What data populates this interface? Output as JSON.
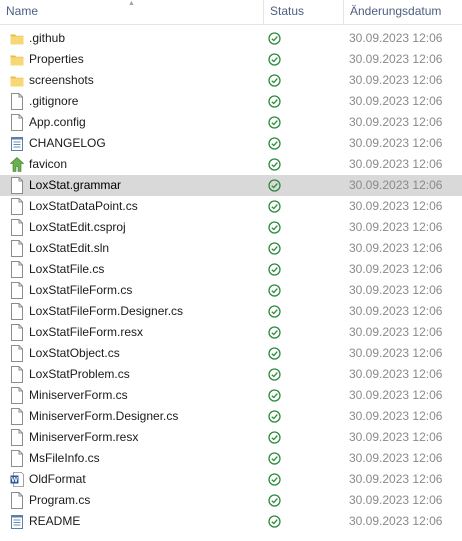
{
  "header": {
    "name_label": "Name",
    "status_label": "Status",
    "date_label": "Änderungsdatum"
  },
  "files": [
    {
      "name": ".github",
      "icon": "folder-icon",
      "status": "synced-icon",
      "date": "30.09.2023 12:06"
    },
    {
      "name": "Properties",
      "icon": "folder-icon",
      "status": "synced-icon",
      "date": "30.09.2023 12:06"
    },
    {
      "name": "screenshots",
      "icon": "folder-icon",
      "status": "synced-icon",
      "date": "30.09.2023 12:06"
    },
    {
      "name": ".gitignore",
      "icon": "file-icon",
      "status": "synced-icon",
      "date": "30.09.2023 12:06"
    },
    {
      "name": "App.config",
      "icon": "file-icon",
      "status": "synced-icon",
      "date": "30.09.2023 12:06"
    },
    {
      "name": "CHANGELOG",
      "icon": "text-document-icon",
      "status": "synced-icon",
      "date": "30.09.2023 12:06"
    },
    {
      "name": "favicon",
      "icon": "favicon-icon",
      "status": "synced-icon",
      "date": "30.09.2023 12:06"
    },
    {
      "name": "LoxStat.grammar",
      "icon": "file-icon",
      "status": "synced-icon",
      "date": "30.09.2023 12:06",
      "selected": true
    },
    {
      "name": "LoxStatDataPoint.cs",
      "icon": "file-icon",
      "status": "synced-icon",
      "date": "30.09.2023 12:06"
    },
    {
      "name": "LoxStatEdit.csproj",
      "icon": "file-icon",
      "status": "synced-icon",
      "date": "30.09.2023 12:06"
    },
    {
      "name": "LoxStatEdit.sln",
      "icon": "file-icon",
      "status": "synced-icon",
      "date": "30.09.2023 12:06"
    },
    {
      "name": "LoxStatFile.cs",
      "icon": "file-icon",
      "status": "synced-icon",
      "date": "30.09.2023 12:06"
    },
    {
      "name": "LoxStatFileForm.cs",
      "icon": "file-icon",
      "status": "synced-icon",
      "date": "30.09.2023 12:06"
    },
    {
      "name": "LoxStatFileForm.Designer.cs",
      "icon": "file-icon",
      "status": "synced-icon",
      "date": "30.09.2023 12:06"
    },
    {
      "name": "LoxStatFileForm.resx",
      "icon": "file-icon",
      "status": "synced-icon",
      "date": "30.09.2023 12:06"
    },
    {
      "name": "LoxStatObject.cs",
      "icon": "file-icon",
      "status": "synced-icon",
      "date": "30.09.2023 12:06"
    },
    {
      "name": "LoxStatProblem.cs",
      "icon": "file-icon",
      "status": "synced-icon",
      "date": "30.09.2023 12:06"
    },
    {
      "name": "MiniserverForm.cs",
      "icon": "file-icon",
      "status": "synced-icon",
      "date": "30.09.2023 12:06"
    },
    {
      "name": "MiniserverForm.Designer.cs",
      "icon": "file-icon",
      "status": "synced-icon",
      "date": "30.09.2023 12:06"
    },
    {
      "name": "MiniserverForm.resx",
      "icon": "file-icon",
      "status": "synced-icon",
      "date": "30.09.2023 12:06"
    },
    {
      "name": "MsFileInfo.cs",
      "icon": "file-icon",
      "status": "synced-icon",
      "date": "30.09.2023 12:06"
    },
    {
      "name": "OldFormat",
      "icon": "word-document-icon",
      "status": "synced-icon",
      "date": "30.09.2023 12:06"
    },
    {
      "name": "Program.cs",
      "icon": "file-icon",
      "status": "synced-icon",
      "date": "30.09.2023 12:06"
    },
    {
      "name": "README",
      "icon": "text-document-icon",
      "status": "synced-icon",
      "date": "30.09.2023 12:06"
    }
  ],
  "colors": {
    "folder": "#f8d775",
    "synced": "#2e8b3e",
    "selection": "#d9d9d9",
    "date_text": "#8a8a8a",
    "header_text": "#4d6082"
  }
}
